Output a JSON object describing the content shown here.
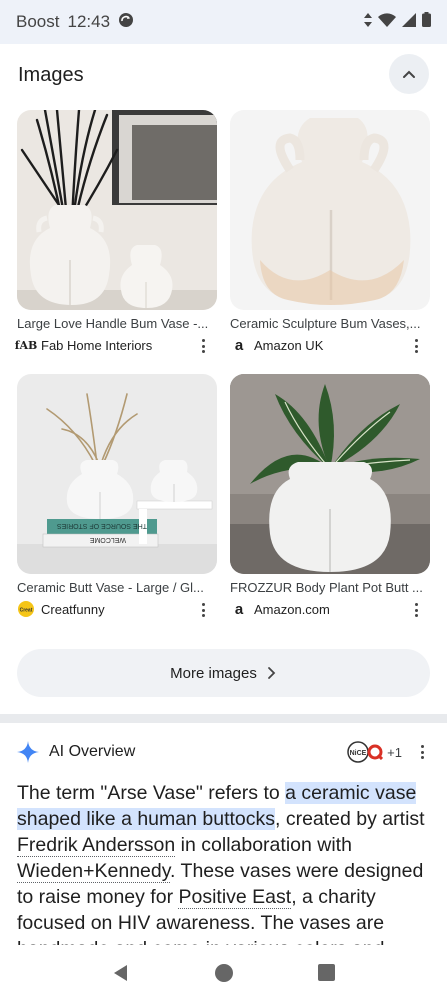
{
  "status_bar": {
    "carrier": "Boost",
    "time": "12:43"
  },
  "images_section": {
    "title": "Images",
    "cards": [
      {
        "title": "Large Love Handle Bum Vase -...",
        "source": "Fab Home Interiors",
        "logo": "fab-logo",
        "thumb": "two-white-vases-with-dried-grass"
      },
      {
        "title": "Ceramic Sculpture Bum Vases,...",
        "source": "Amazon UK",
        "logo": "amazon-logo",
        "thumb": "white-bum-vase"
      },
      {
        "title": "Ceramic Butt Vase - Large / Gl...",
        "source": "Creatfunny",
        "logo": "creatfunny-logo",
        "thumb": "vases-on-books"
      },
      {
        "title": "FROZZUR Body Plant Pot Butt ...",
        "source": "Amazon.com",
        "logo": "amazon-logo",
        "thumb": "plant-pot-butt"
      }
    ],
    "book_text_1": "THE SOURCE OF STORIES",
    "book_text_2": "WELCOME",
    "more_images_label": "More images"
  },
  "ai_overview": {
    "title": "AI Overview",
    "source_count": "+1",
    "paragraph": {
      "p1": "The term \"Arse Vase\" refers to ",
      "h1": "a ceramic vase shaped like a human buttocks",
      "p2": ", created by artist ",
      "l1": "Fredrik Andersson",
      "p3": " in collaboration with ",
      "l2": "Wieden+Kennedy",
      "p4": ". These vases were designed to raise money for ",
      "l3": "Positive East",
      "p5": ", a charity focused on HIV awareness. The vases are handmade and come in various colors and"
    }
  },
  "colors": {
    "accent_highlight": "#d3e3fd",
    "status_bg": "#eef2f9",
    "chip_bg": "#f0f2f5"
  }
}
